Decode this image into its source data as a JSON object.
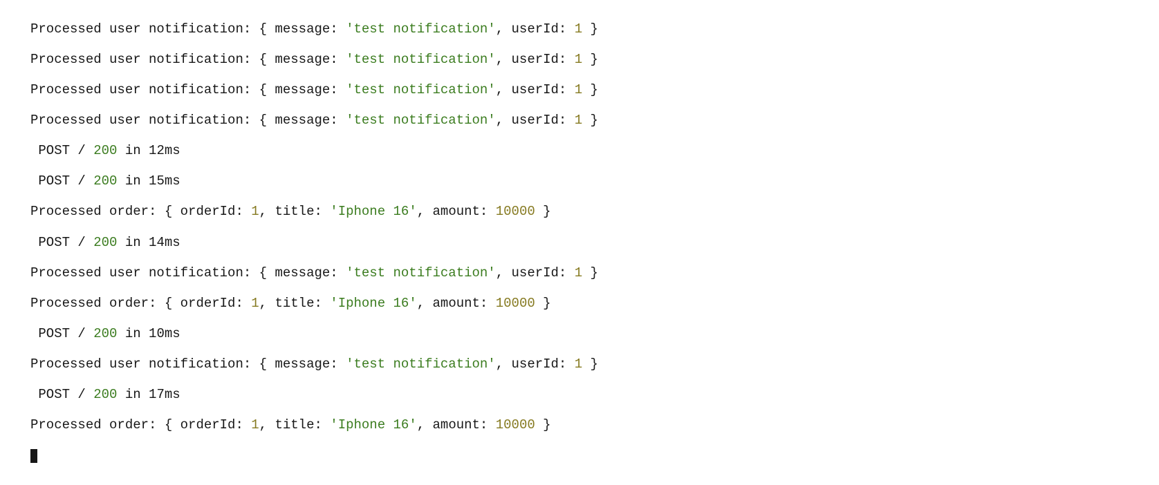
{
  "terminal": {
    "lines": [
      {
        "type": "notification",
        "prefix": "Processed user notification:",
        "messageKey": "message:",
        "messageVal": "'test notification'",
        "userKey": "userId:",
        "userVal": "1"
      },
      {
        "type": "notification",
        "prefix": "Processed user notification:",
        "messageKey": "message:",
        "messageVal": "'test notification'",
        "userKey": "userId:",
        "userVal": "1"
      },
      {
        "type": "notification",
        "prefix": "Processed user notification:",
        "messageKey": "message:",
        "messageVal": "'test notification'",
        "userKey": "userId:",
        "userVal": "1"
      },
      {
        "type": "notification",
        "prefix": "Processed user notification:",
        "messageKey": "message:",
        "messageVal": "'test notification'",
        "userKey": "userId:",
        "userVal": "1"
      },
      {
        "type": "http",
        "method": "POST",
        "path": "/",
        "status": "200",
        "in": "in",
        "time": "12ms"
      },
      {
        "type": "http",
        "method": "POST",
        "path": "/",
        "status": "200",
        "in": "in",
        "time": "15ms"
      },
      {
        "type": "order",
        "prefix": "Processed order:",
        "orderKey": "orderId:",
        "orderVal": "1",
        "titleKey": "title:",
        "titleVal": "'Iphone 16'",
        "amountKey": "amount:",
        "amountVal": "10000"
      },
      {
        "type": "http",
        "method": "POST",
        "path": "/",
        "status": "200",
        "in": "in",
        "time": "14ms"
      },
      {
        "type": "notification",
        "prefix": "Processed user notification:",
        "messageKey": "message:",
        "messageVal": "'test notification'",
        "userKey": "userId:",
        "userVal": "1"
      },
      {
        "type": "order",
        "prefix": "Processed order:",
        "orderKey": "orderId:",
        "orderVal": "1",
        "titleKey": "title:",
        "titleVal": "'Iphone 16'",
        "amountKey": "amount:",
        "amountVal": "10000"
      },
      {
        "type": "http",
        "method": "POST",
        "path": "/",
        "status": "200",
        "in": "in",
        "time": "10ms"
      },
      {
        "type": "notification",
        "prefix": "Processed user notification:",
        "messageKey": "message:",
        "messageVal": "'test notification'",
        "userKey": "userId:",
        "userVal": "1"
      },
      {
        "type": "http",
        "method": "POST",
        "path": "/",
        "status": "200",
        "in": "in",
        "time": "17ms"
      },
      {
        "type": "order",
        "prefix": "Processed order:",
        "orderKey": "orderId:",
        "orderVal": "1",
        "titleKey": "title:",
        "titleVal": "'Iphone 16'",
        "amountKey": "amount:",
        "amountVal": "10000"
      }
    ]
  }
}
